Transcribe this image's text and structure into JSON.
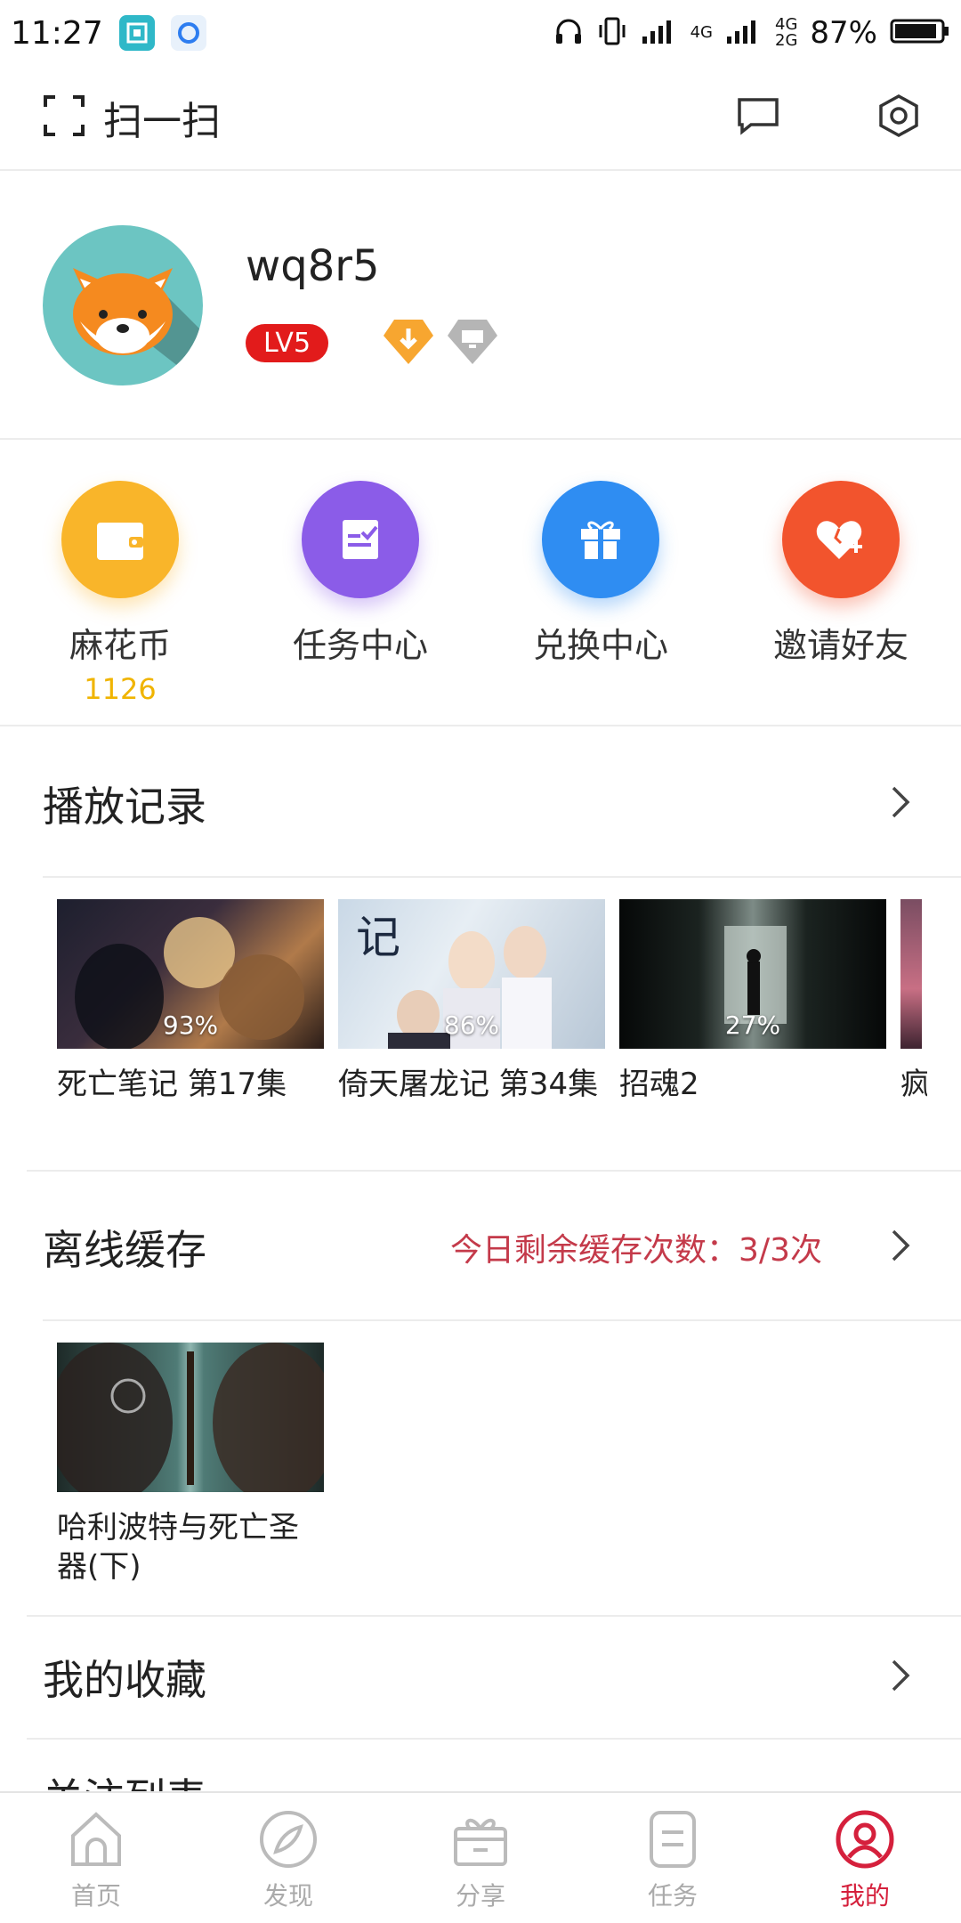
{
  "status_bar": {
    "time": "11:27",
    "network_top": "4G",
    "network_right_top": "4G",
    "network_right_bottom": "2G",
    "battery_percent": "87%",
    "icons": [
      "scan-app-icon",
      "browser-app-icon",
      "headphone-icon",
      "vibrate-icon",
      "signal-icon",
      "battery-icon"
    ]
  },
  "header": {
    "scan_label": "扫一扫",
    "icons": [
      "scan-icon",
      "message-icon",
      "settings-icon"
    ]
  },
  "profile": {
    "username": "wq8r5",
    "level": "LV5",
    "badges": [
      "download-badge-icon",
      "screen-badge-icon"
    ]
  },
  "quick_actions": [
    {
      "label": "麻花币",
      "value": "1126",
      "icon": "wallet-icon",
      "color": "#f9b52a"
    },
    {
      "label": "任务中心",
      "icon": "task-icon",
      "color": "#8b5ce8"
    },
    {
      "label": "兑换中心",
      "icon": "gift-icon",
      "color": "#2f8df2"
    },
    {
      "label": "邀请好友",
      "icon": "heart-plus-icon",
      "color": "#f2542d"
    }
  ],
  "play_history": {
    "title": "播放记录",
    "items": [
      {
        "title": "死亡笔记 第17集",
        "progress": "93%"
      },
      {
        "title": "倚天屠龙记 第34集",
        "progress": "86%"
      },
      {
        "title": "招魂2",
        "progress": "27%"
      },
      {
        "title": "疯"
      }
    ]
  },
  "offline_cache": {
    "title": "离线缓存",
    "note": "今日剩余缓存次数：3/3次",
    "items": [
      {
        "title": "哈利波特与死亡圣器(下)"
      }
    ]
  },
  "favorites": {
    "title": "我的收藏"
  },
  "next_section": {
    "title": "关注列表"
  },
  "bottom_nav": [
    {
      "label": "首页",
      "icon": "home-icon"
    },
    {
      "label": "发现",
      "icon": "discover-icon"
    },
    {
      "label": "分享",
      "icon": "share-icon"
    },
    {
      "label": "任务",
      "icon": "task-nav-icon"
    },
    {
      "label": "我的",
      "icon": "profile-icon",
      "active": true
    }
  ],
  "colors": {
    "accent": "#d5203c",
    "level_badge": "#e21b1b",
    "coin": "#f0b400",
    "note": "#c43a4a"
  }
}
